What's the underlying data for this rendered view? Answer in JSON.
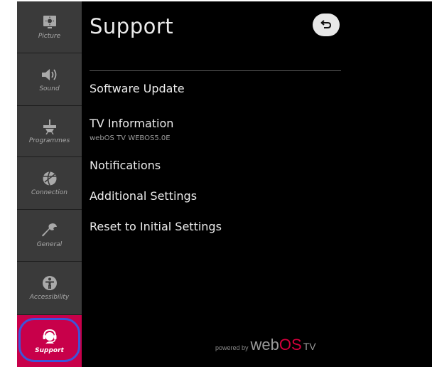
{
  "sidebar": {
    "items": [
      {
        "label": "Picture",
        "icon": "picture-icon"
      },
      {
        "label": "Sound",
        "icon": "speaker-icon"
      },
      {
        "label": "Programmes",
        "icon": "antenna-icon"
      },
      {
        "label": "Connection",
        "icon": "network-icon"
      },
      {
        "label": "General",
        "icon": "wrench-icon"
      },
      {
        "label": "Accessibility",
        "icon": "accessibility-icon"
      },
      {
        "label": "Support",
        "icon": "support-icon",
        "active": true
      }
    ]
  },
  "main": {
    "title": "Support",
    "back_icon": "back-arrow-icon",
    "menu": [
      {
        "label": "Software Update"
      },
      {
        "label": "TV Information",
        "sublabel": "webOS TV WEBOS5.0E"
      },
      {
        "label": "Notifications"
      },
      {
        "label": "Additional Settings"
      },
      {
        "label": "Reset to Initial Settings"
      }
    ]
  },
  "footer": {
    "powered_by": "powered by",
    "brand_web": "web",
    "brand_os": "OS",
    "brand_tv": "TV"
  },
  "colors": {
    "accent": "#c8004a",
    "focus": "#3d55d9",
    "background": "#000000",
    "sidebar": "#3a3a3a"
  }
}
